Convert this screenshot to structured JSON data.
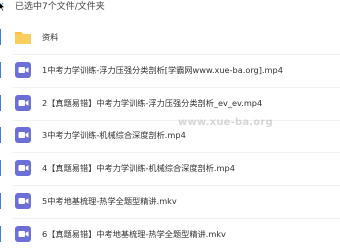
{
  "header": {
    "selection_text": "已选中7个文件/文件夹"
  },
  "watermark": "www.xue-ba.org",
  "colors": {
    "accent": "#3b7de8",
    "folder": "#f6c146",
    "video_icon": "#6b6fd6"
  },
  "items": [
    {
      "type": "folder",
      "icon": "folder-icon",
      "name": "资料"
    },
    {
      "type": "video",
      "icon": "video-icon",
      "name": "1中考力学训练-浮力压强分类剖析[学霸网www.xue-ba.org].mp4"
    },
    {
      "type": "video",
      "icon": "video-icon",
      "name": "2【真题易错】中考力学训练-浮力压强分类剖析_ev_ev.mp4"
    },
    {
      "type": "video",
      "icon": "video-icon",
      "name": "3中考力学训练-机械综合深度剖析.mp4"
    },
    {
      "type": "video",
      "icon": "video-icon",
      "name": "4【真题易错】中考力学训练-机械综合深度剖析.mp4"
    },
    {
      "type": "video",
      "icon": "video-icon",
      "name": "5中考地基梳理-热学全题型精讲.mkv"
    },
    {
      "type": "video",
      "icon": "video-icon",
      "name": "6【真题易错】中考地基梳理-热学全题型精讲.mkv"
    }
  ]
}
